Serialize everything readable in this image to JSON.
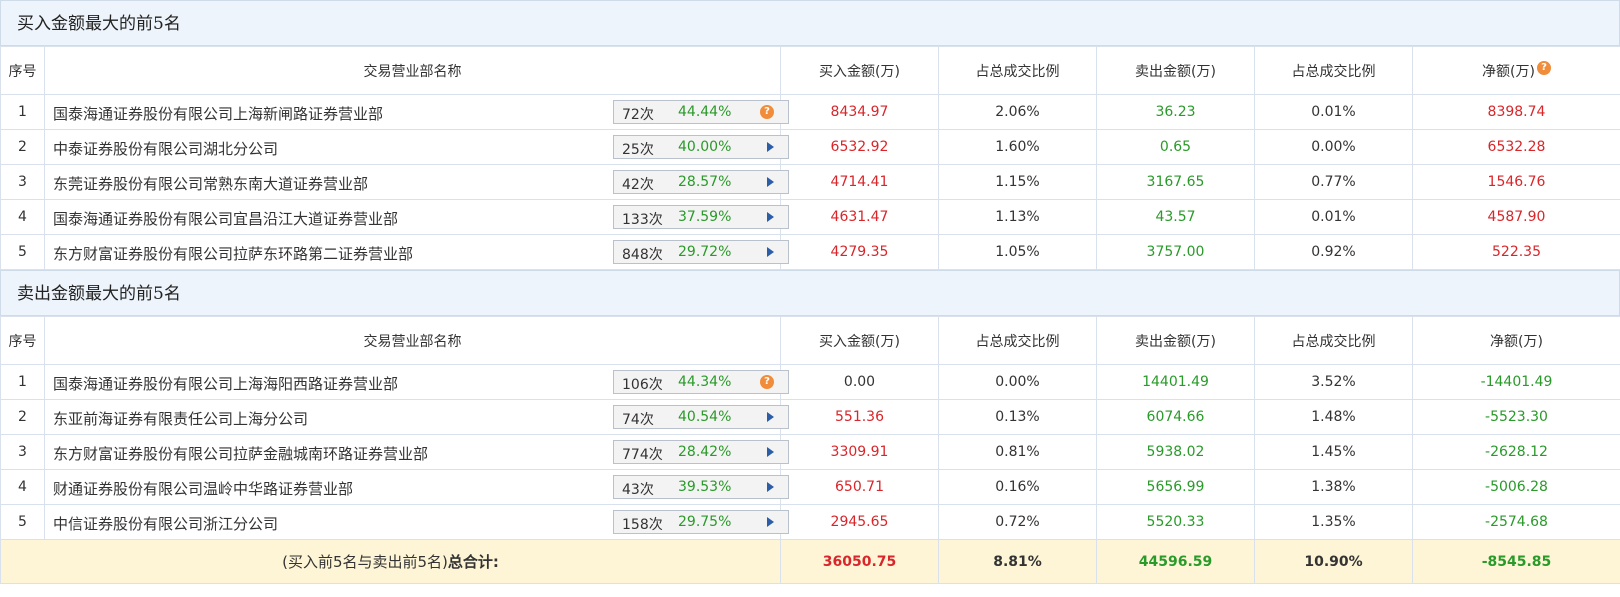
{
  "buy_section": {
    "title": "买入金额最大的前5名",
    "headers": [
      "序号",
      "交易营业部名称",
      "买入金额(万)",
      "占总成交比例",
      "卖出金额(万)",
      "占总成交比例",
      "净额(万)"
    ],
    "rows": [
      {
        "no": "1",
        "name": "国泰海通证券股份有限公司上海新闸路证券营业部",
        "times": "72次",
        "pct": "44.44%",
        "icon": "question-icon",
        "buy": "8434.97",
        "buy_ratio": "2.06%",
        "sell": "36.23",
        "sell_ratio": "0.01%",
        "net": "8398.74"
      },
      {
        "no": "2",
        "name": "中泰证券股份有限公司湖北分公司",
        "times": "25次",
        "pct": "40.00%",
        "icon": "arrow-icon",
        "buy": "6532.92",
        "buy_ratio": "1.60%",
        "sell": "0.65",
        "sell_ratio": "0.00%",
        "net": "6532.28"
      },
      {
        "no": "3",
        "name": "东莞证券股份有限公司常熟东南大道证券营业部",
        "times": "42次",
        "pct": "28.57%",
        "icon": "arrow-icon",
        "buy": "4714.41",
        "buy_ratio": "1.15%",
        "sell": "3167.65",
        "sell_ratio": "0.77%",
        "net": "1546.76"
      },
      {
        "no": "4",
        "name": "国泰海通证券股份有限公司宜昌沿江大道证券营业部",
        "times": "133次",
        "pct": "37.59%",
        "icon": "arrow-icon",
        "buy": "4631.47",
        "buy_ratio": "1.13%",
        "sell": "43.57",
        "sell_ratio": "0.01%",
        "net": "4587.90"
      },
      {
        "no": "5",
        "name": "东方财富证券股份有限公司拉萨东环路第二证券营业部",
        "times": "848次",
        "pct": "29.72%",
        "icon": "arrow-icon",
        "buy": "4279.35",
        "buy_ratio": "1.05%",
        "sell": "3757.00",
        "sell_ratio": "0.92%",
        "net": "522.35"
      }
    ]
  },
  "sell_section": {
    "title": "卖出金额最大的前5名",
    "headers": [
      "序号",
      "交易营业部名称",
      "买入金额(万)",
      "占总成交比例",
      "卖出金额(万)",
      "占总成交比例",
      "净额(万)"
    ],
    "rows": [
      {
        "no": "1",
        "name": "国泰海通证券股份有限公司上海海阳西路证券营业部",
        "times": "106次",
        "pct": "44.34%",
        "icon": "question-icon",
        "buy": "0.00",
        "buy_ratio": "0.00%",
        "sell": "14401.49",
        "sell_ratio": "3.52%",
        "net": "-14401.49"
      },
      {
        "no": "2",
        "name": "东亚前海证券有限责任公司上海分公司",
        "times": "74次",
        "pct": "40.54%",
        "icon": "arrow-icon",
        "buy": "551.36",
        "buy_ratio": "0.13%",
        "sell": "6074.66",
        "sell_ratio": "1.48%",
        "net": "-5523.30"
      },
      {
        "no": "3",
        "name": "东方财富证券股份有限公司拉萨金融城南环路证券营业部",
        "times": "774次",
        "pct": "28.42%",
        "icon": "arrow-icon",
        "buy": "3309.91",
        "buy_ratio": "0.81%",
        "sell": "5938.02",
        "sell_ratio": "1.45%",
        "net": "-2628.12"
      },
      {
        "no": "4",
        "name": "财通证券股份有限公司温岭中华路证券营业部",
        "times": "43次",
        "pct": "39.53%",
        "icon": "arrow-icon",
        "buy": "650.71",
        "buy_ratio": "0.16%",
        "sell": "5656.99",
        "sell_ratio": "1.38%",
        "net": "-5006.28"
      },
      {
        "no": "5",
        "name": "中信证券股份有限公司浙江分公司",
        "times": "158次",
        "pct": "29.75%",
        "icon": "arrow-icon",
        "buy": "2945.65",
        "buy_ratio": "0.72%",
        "sell": "5520.33",
        "sell_ratio": "1.35%",
        "net": "-2574.68"
      }
    ]
  },
  "total": {
    "label_prefix": "(买入前5名与卖出前5名)",
    "label_bold": "总合计:",
    "buy": "36050.75",
    "buy_ratio": "8.81%",
    "sell": "44596.59",
    "sell_ratio": "10.90%",
    "net": "-8545.85"
  },
  "colors": {
    "red": "#d8262a",
    "green": "#2a9a2a",
    "header_bg": "#eef4fb",
    "total_bg": "#fdf5d6"
  }
}
